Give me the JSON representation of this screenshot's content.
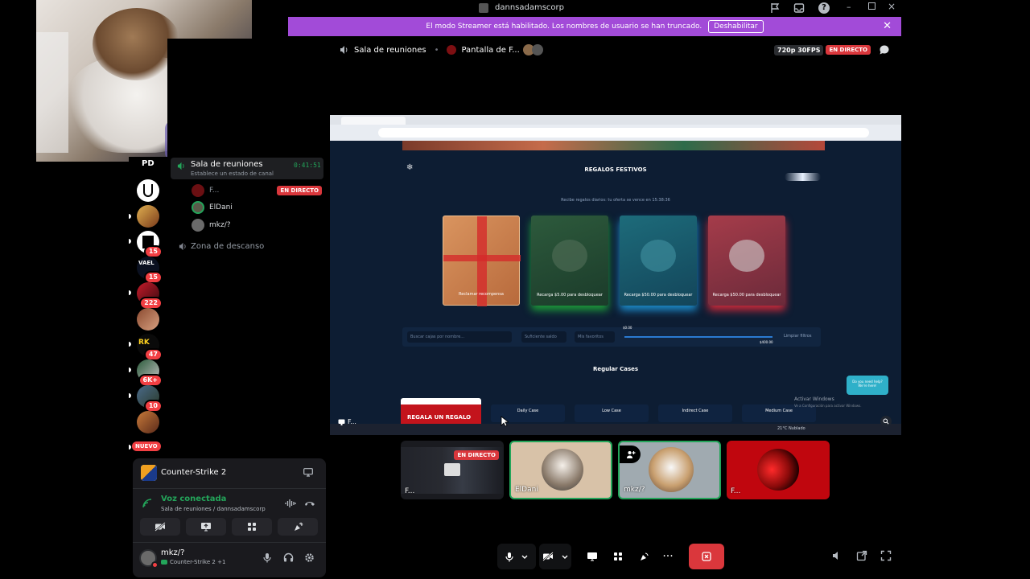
{
  "titlebar": {
    "title": "dannsadamscorp"
  },
  "streamer_banner": {
    "message": "El modo Streamer está habilitado. Los nombres de usuario se han truncado.",
    "disable_label": "Deshabilitar"
  },
  "call_header": {
    "channel": "Sala de reuniones",
    "screen": "Pantalla de F...",
    "quality": "720p 30FPS",
    "live": "EN DIRECTO"
  },
  "rail": {
    "top_label": "PD",
    "badges": [
      "15",
      "15",
      "222",
      "47",
      "6K+",
      "10"
    ],
    "new_label": "NUEVO"
  },
  "channels": {
    "voice_channel": "Sala de reuniones",
    "voice_status": "Establece un estado de canal",
    "timer": "0:41:51",
    "users": [
      {
        "name": "F...",
        "live": "EN DIRECTO"
      },
      {
        "name": "ElDani"
      },
      {
        "name": "mkz/?"
      }
    ],
    "other_channel": "Zona de descanso"
  },
  "activity": {
    "game": "Counter-Strike 2"
  },
  "voice": {
    "status": "Voz conectada",
    "location": "Sala de reuniones / dannsadamscorp"
  },
  "user": {
    "name": "mkz/?",
    "activity": "Counter-Strike 2 +1"
  },
  "stream": {
    "heading": "REGALOS FESTIVOS",
    "subheading": "Recibe regalos diarios: tu oferta se vence en 15:38:36",
    "gifts": [
      {
        "label": "Reclamar recompensa"
      },
      {
        "label": "Recarga $5.00 para desbloquear"
      },
      {
        "label": "Recarga $50.00 para desbloquear"
      },
      {
        "label": "Recarga $50.00 para desbloquear"
      }
    ],
    "search_placeholder": "Buscar cajas por nombre...",
    "filter_a": "Suficiente saldo",
    "filter_b": "Mis favoritos",
    "range_min": "$0.00",
    "range_max": "$400.00",
    "clear_filters": "Limpiar filtros",
    "section": "Regular Cases",
    "cases": [
      "Daily Case",
      "Low Case",
      "Indirect Case",
      "Medium Case"
    ],
    "promo": "REGALA UN REGALO",
    "chat_bubble": "Do you need help? We're here!",
    "watermark_title": "Activar Windows",
    "watermark_sub": "Ve a Configuración para activar Windows.",
    "weather": "21°C Nublado",
    "stream_label": "F..."
  },
  "thumbnails": [
    {
      "label": "F...",
      "live": "EN DIRECTO"
    },
    {
      "label": "ElDani"
    },
    {
      "label": "mkz/?"
    },
    {
      "label": "F..."
    }
  ]
}
